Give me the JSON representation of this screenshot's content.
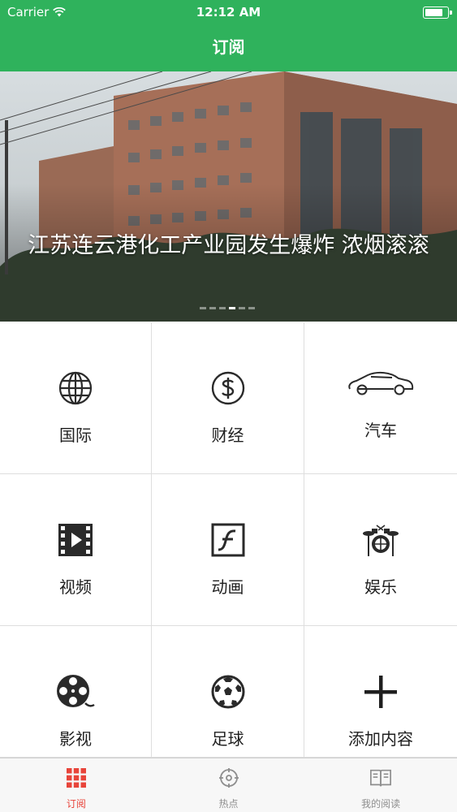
{
  "status_bar": {
    "carrier": "Carrier",
    "time": "12:12 AM",
    "battery_level": 0.85
  },
  "nav": {
    "title": "订阅"
  },
  "banner": {
    "caption": "江苏连云港化工产业园发生爆炸 浓烟滚滚",
    "page_count": 6,
    "active_page": 4
  },
  "categories": [
    {
      "label": "国际",
      "icon": "globe-icon"
    },
    {
      "label": "财经",
      "icon": "dollar-icon"
    },
    {
      "label": "汽车",
      "icon": "car-icon"
    },
    {
      "label": "视频",
      "icon": "film-play-icon"
    },
    {
      "label": "动画",
      "icon": "flash-icon"
    },
    {
      "label": "娱乐",
      "icon": "drum-kit-icon"
    },
    {
      "label": "影视",
      "icon": "film-reel-icon"
    },
    {
      "label": "足球",
      "icon": "soccer-ball-icon"
    },
    {
      "label": "添加内容",
      "icon": "plus-icon"
    }
  ],
  "tabs": [
    {
      "label": "订阅",
      "icon": "grid-icon",
      "active": true
    },
    {
      "label": "热点",
      "icon": "target-icon",
      "active": false
    },
    {
      "label": "我的阅读",
      "icon": "book-icon",
      "active": false
    }
  ],
  "colors": {
    "nav_green": "#2fb25c",
    "tab_active": "#e8443a",
    "tab_inactive": "#8e8e8e"
  }
}
